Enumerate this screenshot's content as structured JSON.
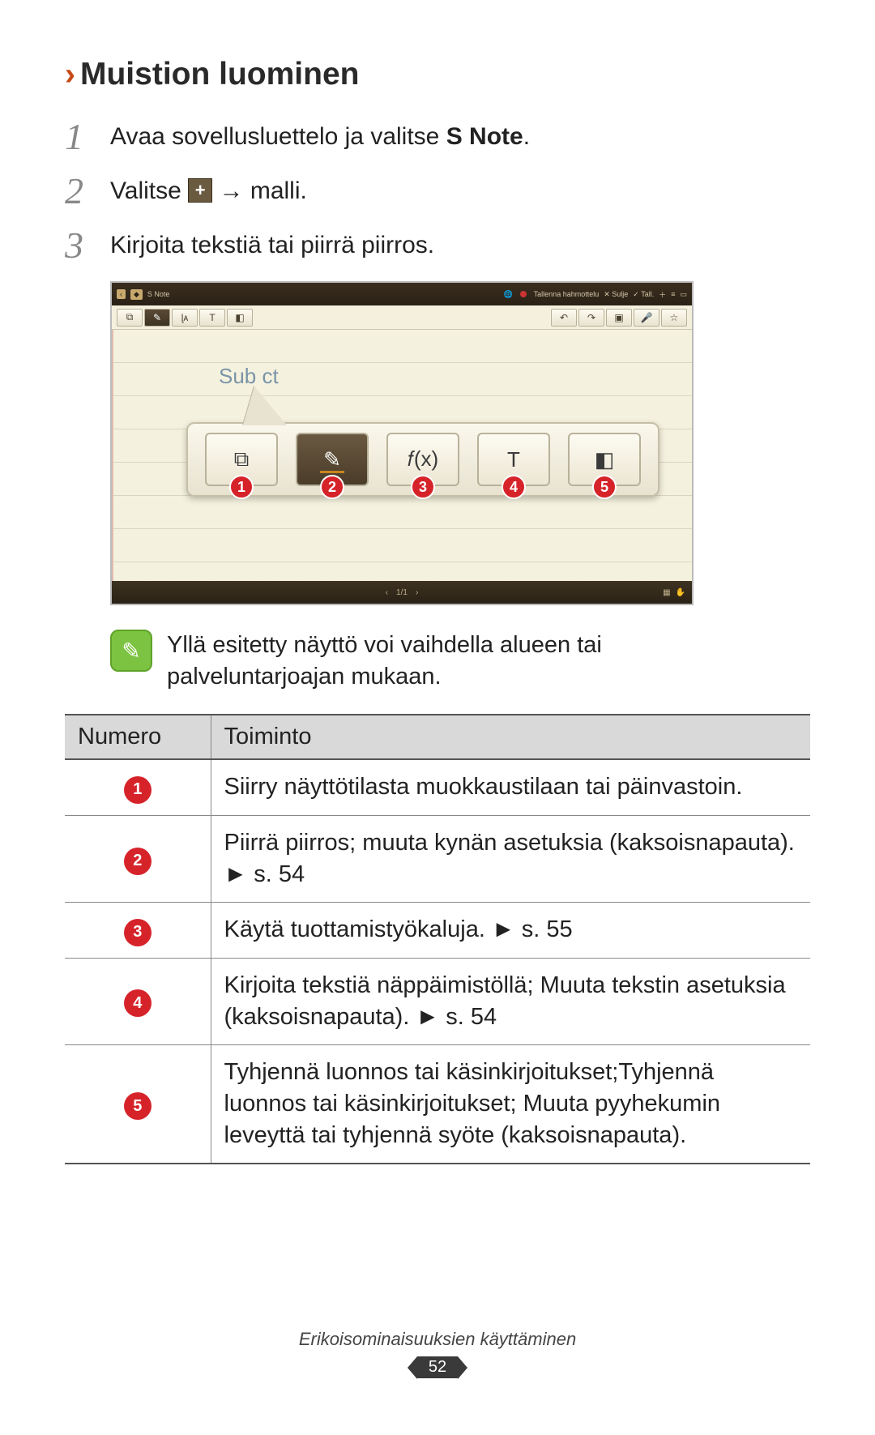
{
  "heading": "Muistion luominen",
  "steps": [
    {
      "num": "1",
      "pre": "Avaa sovellusluettelo ja valitse ",
      "bold": "S Note",
      "post": "."
    },
    {
      "num": "2",
      "pre": "Valitse ",
      "post": " → malli."
    },
    {
      "num": "3",
      "pre": "Kirjoita tekstiä tai piirrä piirros.",
      "post": ""
    }
  ],
  "screenshot": {
    "titlebar": {
      "app": "S Note",
      "rec_label": "Tallenna hahmottelu",
      "close": "Sulje",
      "save": "Tall."
    },
    "subject_placeholder": "Sub   ct",
    "toolbar_icons": [
      "⧉",
      "✎",
      "𝑓(x)",
      "T",
      "◧"
    ],
    "callouts": [
      "1",
      "2",
      "3",
      "4",
      "5"
    ],
    "pager": "1/1"
  },
  "note_text": "Yllä esitetty näyttö voi vaihdella alueen tai palveluntarjoajan mukaan.",
  "table": {
    "headers": [
      "Numero",
      "Toiminto"
    ],
    "rows": [
      {
        "n": "1",
        "t": "Siirry näyttötilasta muokkaustilaan tai päinvastoin."
      },
      {
        "n": "2",
        "t": "Piirrä piirros; muuta kynän asetuksia (kaksoisnapauta). ► s. 54"
      },
      {
        "n": "3",
        "t": "Käytä tuottamistyökaluja. ► s. 55"
      },
      {
        "n": "4",
        "t": "Kirjoita tekstiä näppäimistöllä; Muuta tekstin asetuksia (kaksoisnapauta). ► s. 54"
      },
      {
        "n": "5",
        "t": "Tyhjennä luonnos tai käsinkirjoitukset;Tyhjennä luonnos tai käsinkirjoitukset; Muuta pyyhekumin leveyttä tai tyhjennä syöte (kaksoisnapauta)."
      }
    ]
  },
  "footer": {
    "section": "Erikoisominaisuuksien käyttäminen",
    "page": "52"
  }
}
